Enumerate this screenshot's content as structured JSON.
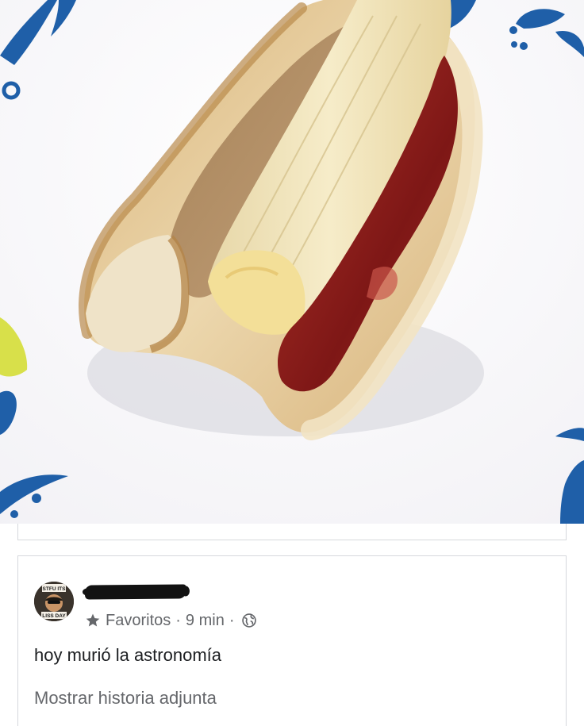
{
  "post": {
    "image": {
      "subject": "sandwich-photo",
      "colors": {
        "plate": "#f4f3f7",
        "plate_pattern": "#1f5fa8",
        "bread": "#e9d3a6",
        "crust": "#c89a5a",
        "banana": "#f1e4bd",
        "jelly": "#8e1e1c",
        "peanut_butter": "#b08a5a"
      }
    },
    "author": {
      "avatar_icon": "avatar-image",
      "avatar_text_top": "STFU ITS",
      "avatar_text_bottom": "LISS DAY"
    },
    "meta": {
      "star_icon": "star-icon",
      "favorites_label": "Favoritos",
      "sep1": "·",
      "time": "9 min",
      "sep2": "·",
      "audience_icon": "globe-icon"
    },
    "text": "hoy murió la astronomía",
    "show_story_label": "Mostrar historia adjunta"
  },
  "colors": {
    "secondary_text": "#65676b",
    "primary_text": "#1c1e21",
    "card_border": "#d6d8dc"
  }
}
